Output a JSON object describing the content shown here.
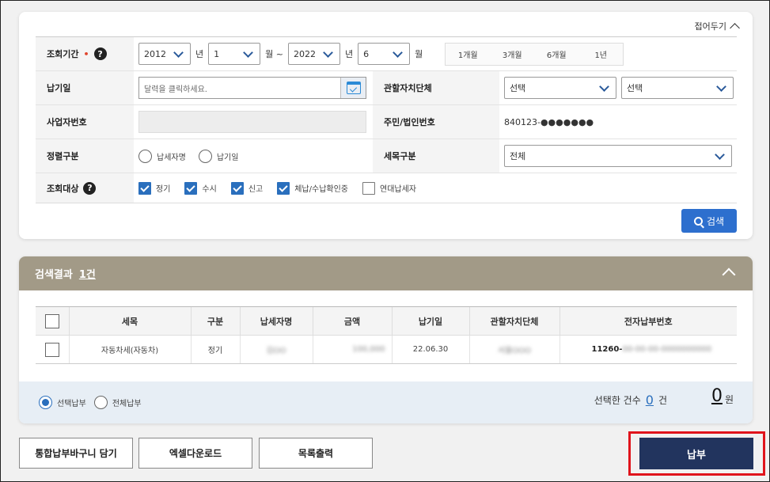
{
  "search_panel": {
    "collapse_label": "접어두기",
    "period": {
      "label": "조회기간",
      "required_mark": "•",
      "from_year": "2012",
      "year_unit": "년",
      "from_month": "1",
      "month_unit_tilde": "월 ~",
      "to_year": "2022",
      "to_year_unit": "년",
      "to_month": "6",
      "to_month_unit": "월",
      "ranges": [
        "1개월",
        "3개월",
        "6개월",
        "1년"
      ]
    },
    "pay_date": {
      "label": "납기일",
      "placeholder": "달력을 클릭하세요."
    },
    "jurisdiction": {
      "label": "관할자치단체",
      "select1": "선택",
      "select2": "선택"
    },
    "business_no": {
      "label": "사업자번호"
    },
    "resident_no": {
      "label": "주민/법인번호",
      "value": "840123-●●●●●●●"
    },
    "sort": {
      "label": "정렬구분",
      "options": [
        "납세자명",
        "납기일"
      ]
    },
    "tax_item": {
      "label": "세목구분",
      "value": "전체"
    },
    "target": {
      "label": "조회대상",
      "options": [
        {
          "label": "정기",
          "checked": true
        },
        {
          "label": "수시",
          "checked": true
        },
        {
          "label": "신고",
          "checked": true
        },
        {
          "label": "체납/수납확인중",
          "checked": true
        },
        {
          "label": "연대납세자",
          "checked": false
        }
      ]
    },
    "search_button": "검색"
  },
  "results": {
    "title": "검색결과",
    "count": "1건",
    "columns": [
      "세목",
      "구분",
      "납세자명",
      "금액",
      "납기일",
      "관할자치단체",
      "전자납부번호"
    ],
    "rows": [
      {
        "item": "자동차세(자동차)",
        "type": "정기",
        "payer": "김OO",
        "amount": "100,000",
        "due": "22.06.30",
        "region": "서울OOO",
        "epay_no": "11260-",
        "epay_rest": "00-00-00-0000000000"
      }
    ],
    "pay_options": [
      "선택납부",
      "전체납부"
    ],
    "selected_count_label": "선택한 건수",
    "selected_count": "0",
    "count_unit": "건",
    "total_amount": "0",
    "currency": "원"
  },
  "bottom_buttons": {
    "cart": "통합납부바구니 담기",
    "excel": "엑셀다운로드",
    "print": "목록출력",
    "pay": "납부"
  }
}
